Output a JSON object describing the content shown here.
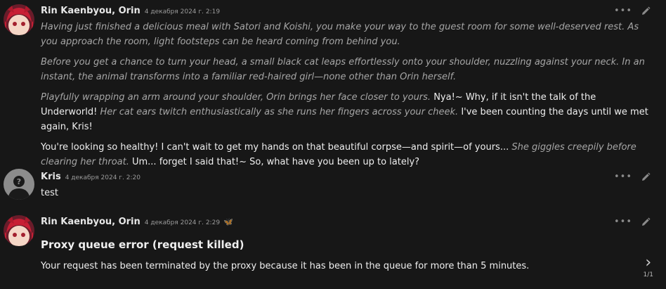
{
  "messages": [
    {
      "name": "Rin Kaenbyou, Orin",
      "timestamp": "4 декабря 2024 г. 2:19",
      "avatar_icon": "orin-avatar",
      "paragraphs": [
        [
          {
            "style": "italic",
            "text": "Having just finished a delicious meal with Satori and Koishi, you make your way to the guest room for some well-deserved rest. As you approach the room, light footsteps can be heard coming from behind you."
          }
        ],
        [
          {
            "style": "italic",
            "text": "Before you get a chance to turn your head, a small black cat leaps effortlessly onto your shoulder, nuzzling against your neck. In an instant, the animal transforms into a familiar red-haired girl—none other than Orin herself."
          }
        ],
        [
          {
            "style": "italic",
            "text": "Playfully wrapping an arm around your shoulder, Orin brings her face closer to yours. "
          },
          {
            "style": "quote",
            "text": "Nya!~ Why, if it isn't the talk of the Underworld! "
          },
          {
            "style": "italic",
            "text": "Her cat ears twitch enthusiastically as she runs her fingers across your cheek. "
          },
          {
            "style": "quote",
            "text": "I've been counting the days until we met again, Kris!"
          }
        ],
        [
          {
            "style": "quote",
            "text": "You're looking so healthy! I can't wait to get my hands on that beautiful corpse—and spirit—of yours... "
          },
          {
            "style": "italic",
            "text": "She giggles creepily before clearing her throat. "
          },
          {
            "style": "quote",
            "text": "Um... forget I said that!~ So, what have you been up to lately?"
          }
        ]
      ]
    },
    {
      "name": "Kris",
      "timestamp": "4 декабря 2024 г. 2:20",
      "avatar_icon": "unknown-user-avatar",
      "text": "test"
    },
    {
      "name": "Rin Kaenbyou, Orin",
      "timestamp": "4 декабря 2024 г. 2:29",
      "avatar_icon": "orin-avatar",
      "badge_icon": "butterfly-icon",
      "badge_glyph": "🦋",
      "error_title": "Proxy queue error (request killed)",
      "error_text": "Your request has been terminated by the proxy because it has been in the queue for more than 5 minutes."
    }
  ],
  "actions": {
    "more_glyph": "•••",
    "more_icon": "more-options-icon",
    "edit_icon": "edit-pencil-icon"
  },
  "swipe": {
    "next_glyph": "›",
    "counter": "1/1"
  },
  "colors": {
    "background": "#171717",
    "name": "#e6e6e6",
    "italic_narration": "#a6a6a6",
    "dialogue": "#efefef",
    "timestamp": "#9a9a9a"
  }
}
